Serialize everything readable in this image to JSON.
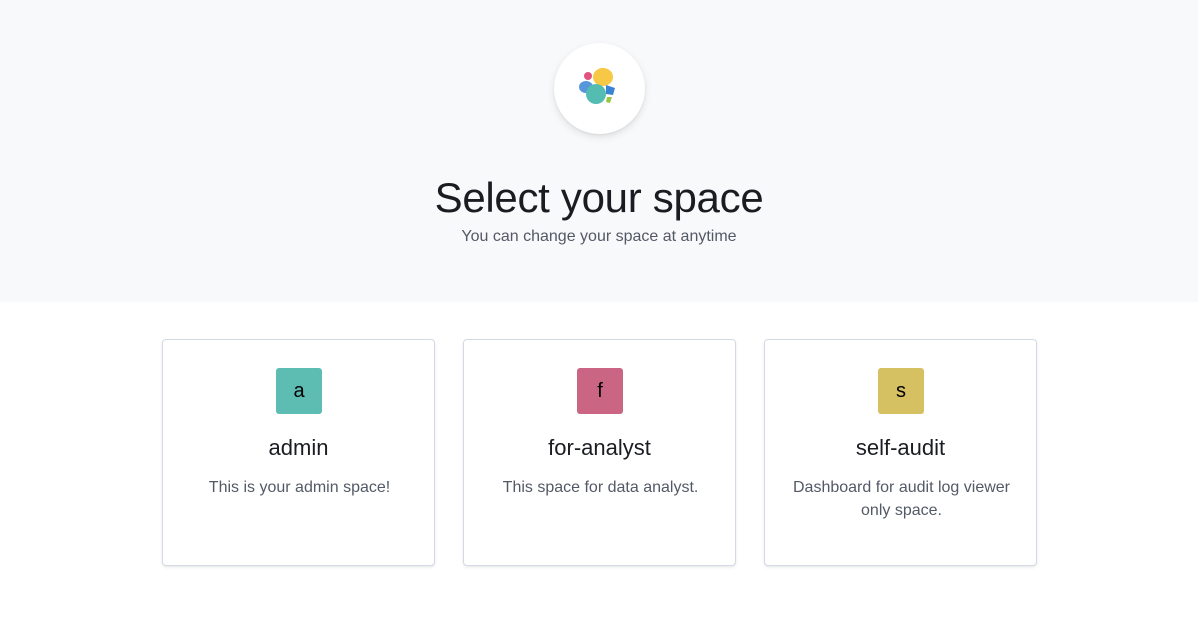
{
  "header": {
    "title": "Select your space",
    "subtitle": "You can change your space at anytime",
    "logo_icon": "elastic-logo-icon"
  },
  "colors": {
    "header_bg": "#f8f9fb",
    "logo_yellow": "#f7c846",
    "logo_teal": "#55bcb2",
    "logo_blue": "#3a84d6",
    "logo_pink": "#e0547e",
    "logo_green": "#9bc545",
    "logo_light_blue": "#5aa6e6"
  },
  "spaces": [
    {
      "initial": "a",
      "name": "admin",
      "description": "This is your admin space!",
      "color": "#5ebdb3"
    },
    {
      "initial": "f",
      "name": "for-analyst",
      "description": "This space for data analyst.",
      "color": "#cb6584"
    },
    {
      "initial": "s",
      "name": "self-audit",
      "description": "Dashboard for audit log viewer only space.",
      "color": "#d5c062"
    }
  ]
}
